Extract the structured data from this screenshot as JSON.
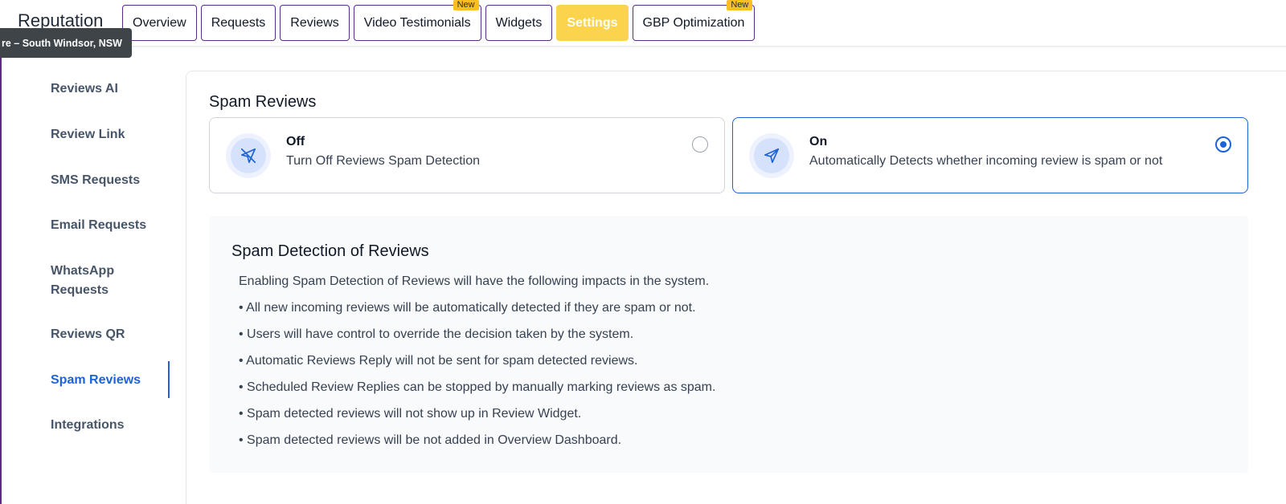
{
  "header": {
    "app_title": "Reputation",
    "tabs": [
      {
        "label": "Overview",
        "badge": ""
      },
      {
        "label": "Requests",
        "badge": ""
      },
      {
        "label": "Reviews",
        "badge": ""
      },
      {
        "label": "Video Testimonials",
        "badge": "New"
      },
      {
        "label": "Widgets",
        "badge": ""
      },
      {
        "label": "Settings",
        "badge": "",
        "active": true
      },
      {
        "label": "GBP Optimization",
        "badge": "New"
      }
    ]
  },
  "location_tooltip": "re – South Windsor, NSW",
  "sidebar": {
    "items": [
      {
        "label": "Reviews AI"
      },
      {
        "label": "Review Link"
      },
      {
        "label": "SMS Requests"
      },
      {
        "label": "Email Requests"
      },
      {
        "label": "WhatsApp Requests"
      },
      {
        "label": "Reviews QR"
      },
      {
        "label": "Spam Reviews",
        "active": true
      },
      {
        "label": "Integrations"
      }
    ]
  },
  "spam": {
    "title": "Spam Reviews",
    "options": {
      "off": {
        "title": "Off",
        "description": "Turn Off Reviews Spam Detection",
        "selected": false,
        "icon": "send-off-icon"
      },
      "on": {
        "title": "On",
        "description": "Automatically Detects whether incoming review is spam or not",
        "selected": true,
        "icon": "send-icon"
      }
    },
    "info": {
      "title": "Spam Detection of Reviews",
      "intro": "Enabling Spam Detection of Reviews will have the following impacts in the system.",
      "points": [
        "• All new incoming reviews will be automatically detected if they are spam or not.",
        "• Users will have control to override the decision taken by the system.",
        "• Automatic Reviews Reply will not be sent for spam detected reviews.",
        "• Scheduled Review Replies can be stopped by manually marking reviews as spam.",
        "• Spam detected reviews will not show up in Review Widget.",
        "• Spam detected reviews will be not added in Overview Dashboard."
      ]
    }
  },
  "colors": {
    "accent": "#1d63d8",
    "active_tab": "#fcd34d",
    "badge": "#fbbf24",
    "tab_border": "#5b2a86"
  }
}
